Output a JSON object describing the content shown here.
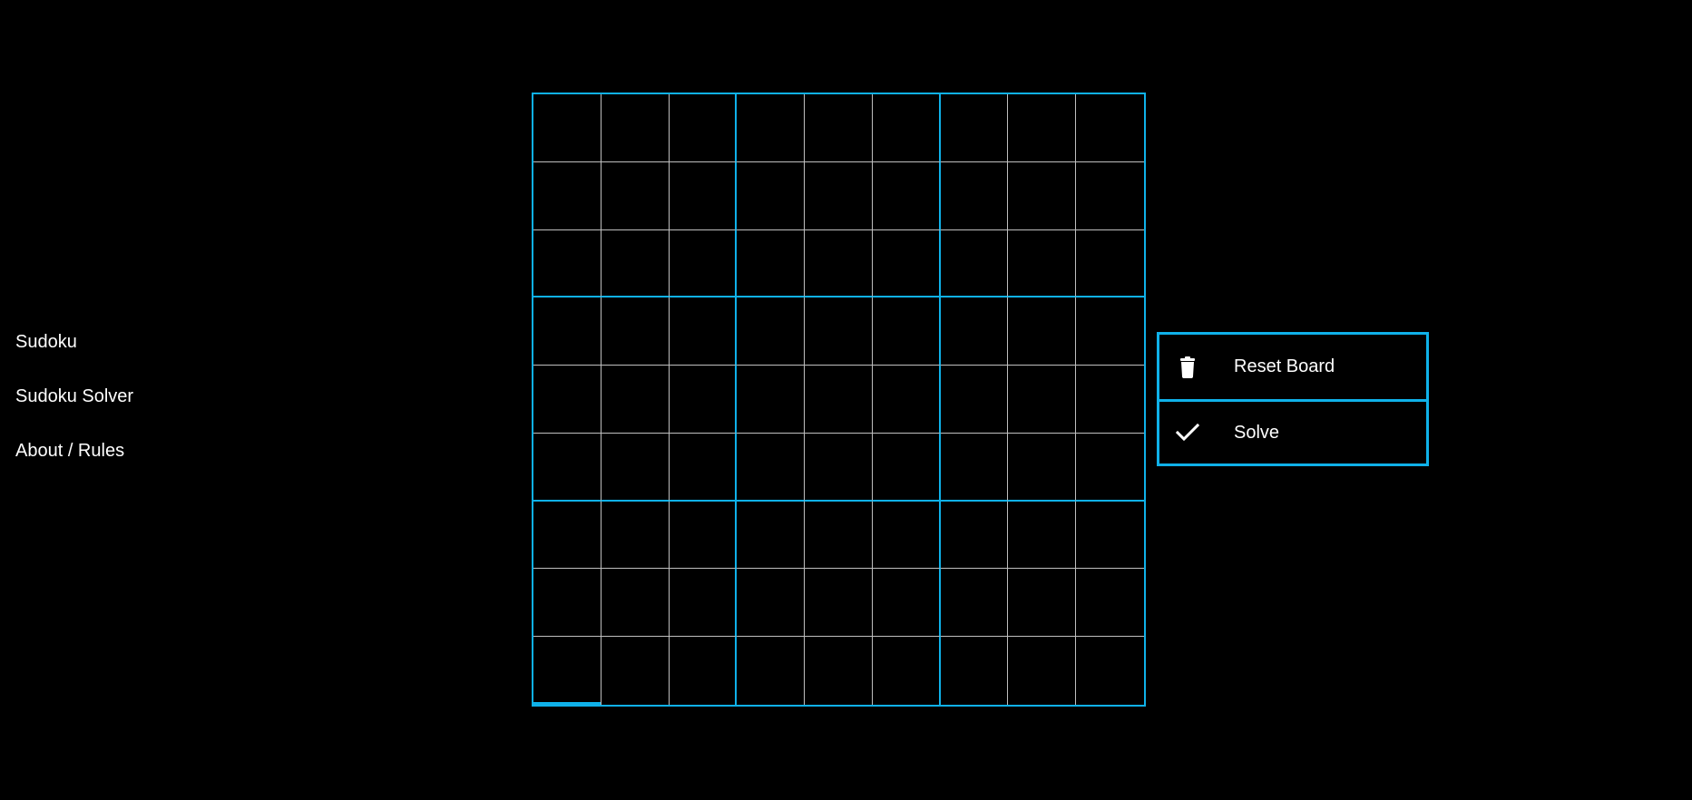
{
  "nav": {
    "items": [
      {
        "label": "Sudoku"
      },
      {
        "label": "Sudoku Solver"
      },
      {
        "label": "About / Rules"
      }
    ]
  },
  "board": {
    "size": 9,
    "cells": [
      [
        "",
        "",
        "",
        "",
        "",
        "",
        "",
        "",
        ""
      ],
      [
        "",
        "",
        "",
        "",
        "",
        "",
        "",
        "",
        ""
      ],
      [
        "",
        "",
        "",
        "",
        "",
        "",
        "",
        "",
        ""
      ],
      [
        "",
        "",
        "",
        "",
        "",
        "",
        "",
        "",
        ""
      ],
      [
        "",
        "",
        "",
        "",
        "",
        "",
        "",
        "",
        ""
      ],
      [
        "",
        "",
        "",
        "",
        "",
        "",
        "",
        "",
        ""
      ],
      [
        "",
        "",
        "",
        "",
        "",
        "",
        "",
        "",
        ""
      ],
      [
        "",
        "",
        "",
        "",
        "",
        "",
        "",
        "",
        ""
      ],
      [
        "",
        "",
        "",
        "",
        "",
        "",
        "",
        "",
        ""
      ]
    ],
    "selected": {
      "row": 8,
      "col": 0
    }
  },
  "actions": {
    "reset": {
      "label": "Reset Board",
      "icon": "trash-icon"
    },
    "solve": {
      "label": "Solve",
      "icon": "check-icon"
    }
  },
  "colors": {
    "accent": "#0fb1e9",
    "background": "#000000",
    "text": "#ffffff",
    "grid_line": "#bfbfbf"
  }
}
